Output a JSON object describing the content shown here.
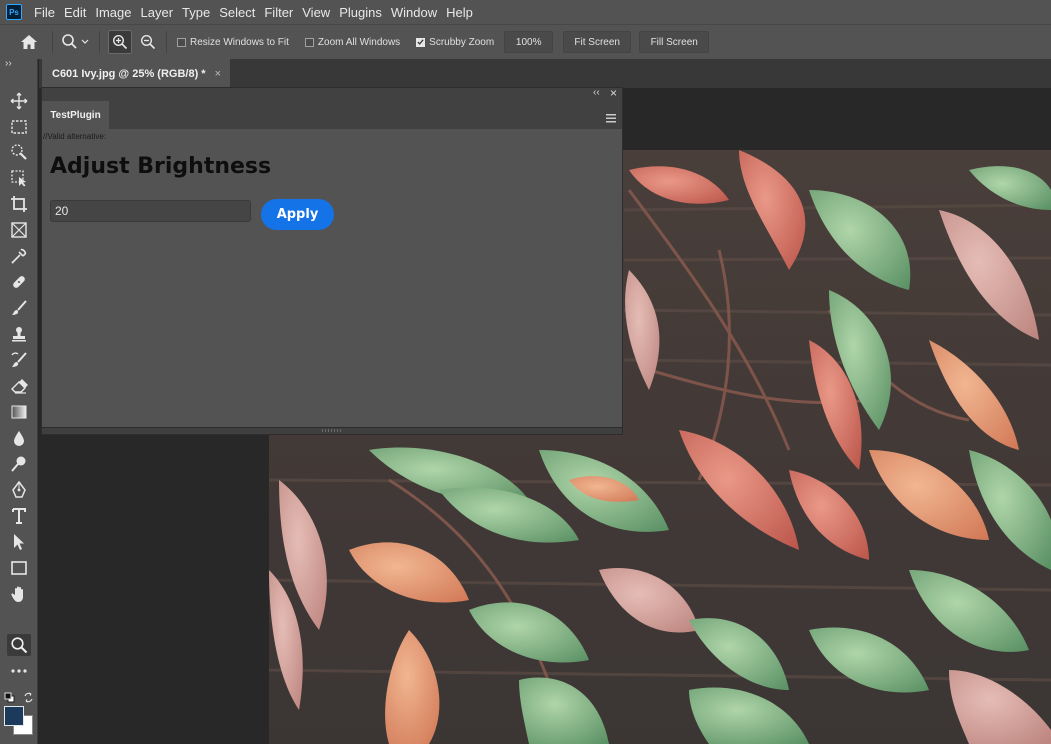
{
  "app": {
    "logo_text": "Ps",
    "menu": [
      "File",
      "Edit",
      "Image",
      "Layer",
      "Type",
      "Select",
      "Filter",
      "View",
      "Plugins",
      "Window",
      "Help"
    ]
  },
  "options_bar": {
    "resize_windows_label": "Resize Windows to Fit",
    "resize_windows_checked": false,
    "zoom_all_label": "Zoom All Windows",
    "zoom_all_checked": false,
    "scrubby_zoom_label": "Scrubby Zoom",
    "scrubby_zoom_checked": true,
    "zoom_percent": "100%",
    "fit_screen_label": "Fit Screen",
    "fill_screen_label": "Fill Screen"
  },
  "document": {
    "tab_title": "C601 Ivy.jpg @ 25% (RGB/8) *",
    "close_glyph": "×"
  },
  "panel": {
    "tab_label": "TestPlugin",
    "collapse_glyph": "‹‹",
    "close_glyph": "×",
    "comment": "//Valid alternative:",
    "heading": "Adjust Brightness",
    "input_value": "20",
    "apply_label": "Apply"
  },
  "toolbar": {
    "expand_glyph": "››",
    "active_tool": "zoom-tool",
    "foreground_color": "#1b3a5c",
    "background_color": "#ffffff"
  },
  "colors": {
    "accent": "#1473e6",
    "menubar": "#535353",
    "canvas_bg": "#282828"
  }
}
